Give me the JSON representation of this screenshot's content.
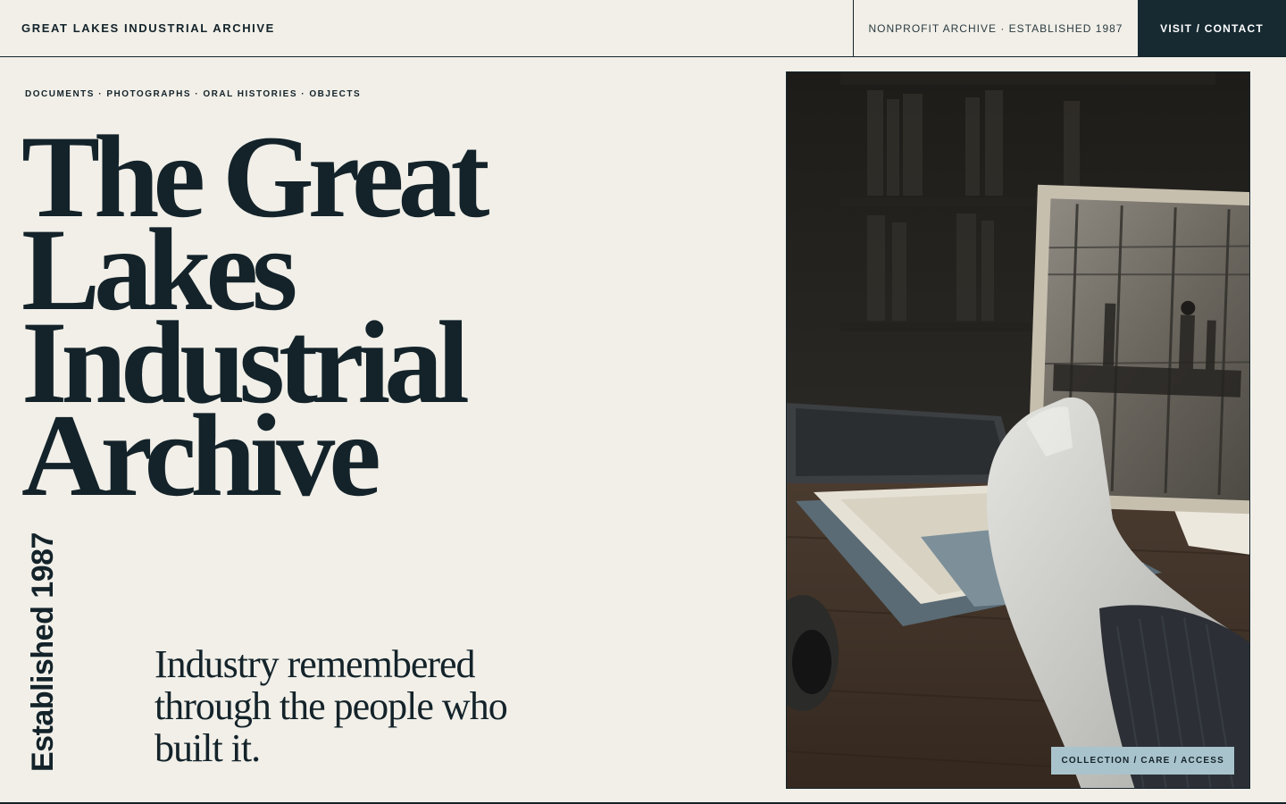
{
  "header": {
    "brand": "GREAT LAKES INDUSTRIAL ARCHIVE",
    "meta": "NONPROFIT ARCHIVE · ESTABLISHED 1987",
    "cta": "VISIT / CONTACT"
  },
  "hero": {
    "categories": "DOCUMENTS · PHOTOGRAPHS · ORAL HISTORIES · OBJECTS",
    "title_lines": [
      "The Great",
      "Lakes",
      "Industrial",
      "Archive"
    ],
    "established": "Established 1987",
    "tagline": "Industry remembered through the people who built it."
  },
  "photo": {
    "alt": "Gloved hand holding an archival factory photograph",
    "tag": "COLLECTION / CARE / ACCESS"
  },
  "colors": {
    "background": "#f1efe8",
    "ink": "#14232a",
    "cta_background": "#172a32",
    "tag_background": "#a9c3cc"
  }
}
